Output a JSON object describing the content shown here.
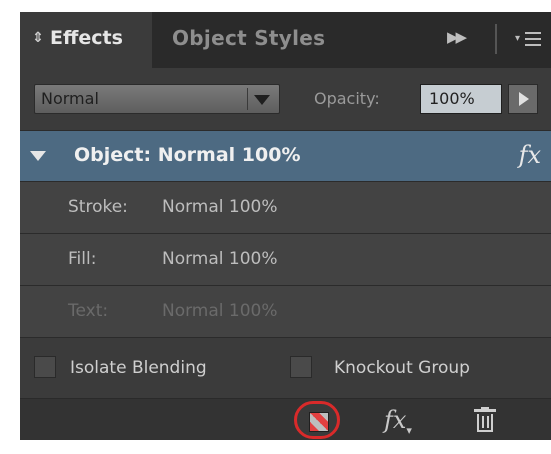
{
  "tabs": {
    "effects_label": "Effects",
    "object_styles_label": "Object Styles"
  },
  "blend": {
    "mode_value": "Normal",
    "opacity_label": "Opacity:",
    "opacity_value": "100%"
  },
  "object": {
    "label": "Object: Normal 100%",
    "fx_label": "fx"
  },
  "attributes": [
    {
      "name": "Stroke:",
      "value": "Normal 100%"
    },
    {
      "name": "Fill:",
      "value": "Normal 100%"
    },
    {
      "name": "Text:",
      "value": "Normal 100%"
    }
  ],
  "options": {
    "isolate_label": "Isolate Blending",
    "knockout_label": "Knockout Group"
  },
  "bottom": {
    "fx_label": "fx"
  },
  "colors": {
    "panel_bg": "#3b3b3b",
    "selected_row": "#4d6a82",
    "highlight_ring": "#d92a2a"
  }
}
